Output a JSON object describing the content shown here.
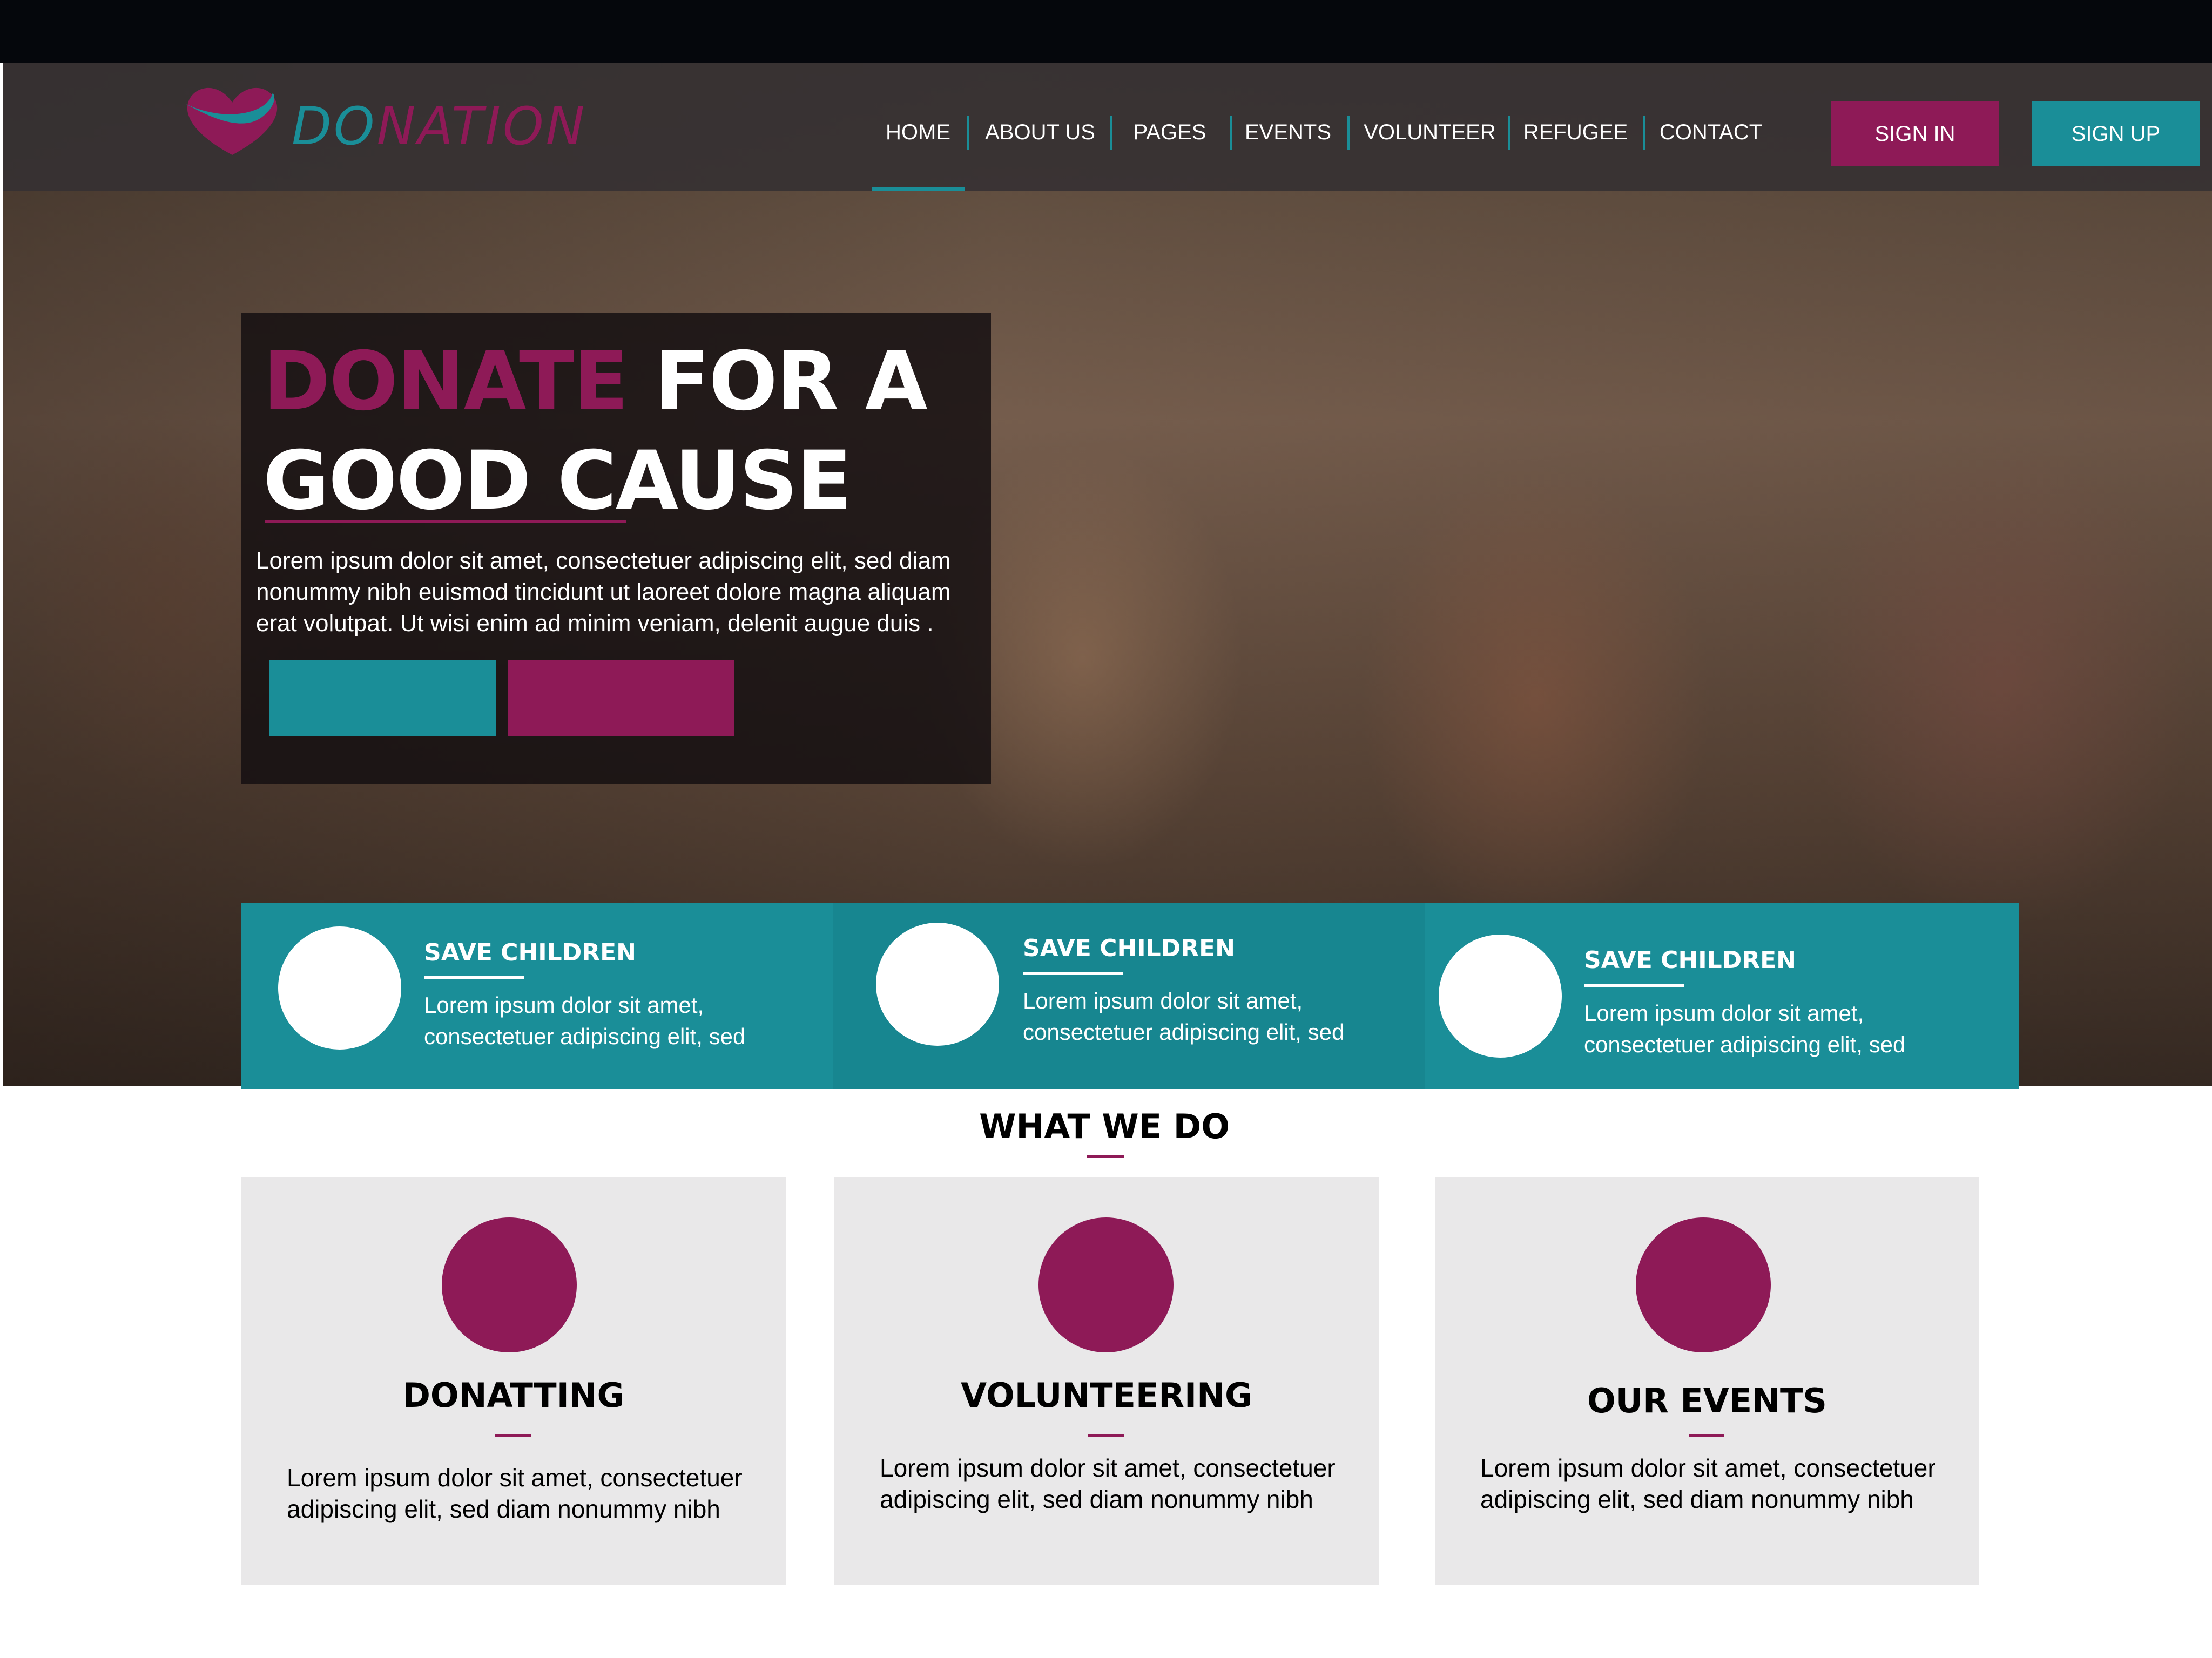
{
  "brand": {
    "name_part1": "DO",
    "name_part2": "NATION",
    "accent_teal": "#1a8e98",
    "accent_pink": "#8e1a57",
    "logo_icon": "heart-swoosh-icon"
  },
  "nav": {
    "items": [
      "HOME",
      "ABOUT US",
      "PAGES",
      "EVENTS",
      "VOLUNTEER",
      "REFUGEE",
      "CONTACT"
    ],
    "active": "HOME",
    "sign_in": "SIGN IN",
    "sign_up": "SIGN UP"
  },
  "hero": {
    "title_highlight": "DONATE",
    "title_rest_line1": " FOR A",
    "title_line2": "GOOD CAUSE",
    "description": "Lorem ipsum dolor sit amet, consectetuer adipiscing elit, sed diam nonummy nibh euismod tincidunt ut laoreet dolore magna aliquam erat volutpat. Ut wisi enim ad minim veniam, delenit augue duis ."
  },
  "features": [
    {
      "title": "SAVE CHILDREN",
      "text": "Lorem ipsum dolor sit amet, consectetuer adipiscing elit, sed"
    },
    {
      "title": "SAVE CHILDREN",
      "text": "Lorem ipsum dolor sit amet, consectetuer adipiscing elit, sed"
    },
    {
      "title": "SAVE CHILDREN",
      "text": "Lorem ipsum dolor sit amet, consectetuer adipiscing elit, sed"
    }
  ],
  "what_we_do": {
    "title": "WHAT WE DO",
    "cards": [
      {
        "title": "DONATTING",
        "text": "Lorem ipsum dolor sit amet, consectetuer adipiscing elit, sed diam nonummy nibh"
      },
      {
        "title": "VOLUNTEERING",
        "text": "Lorem ipsum dolor sit amet, consectetuer adipiscing elit, sed diam nonummy nibh"
      },
      {
        "title": "OUR EVENTS",
        "text": "Lorem ipsum dolor sit amet, consectetuer adipiscing elit, sed diam nonummy nibh"
      }
    ]
  }
}
